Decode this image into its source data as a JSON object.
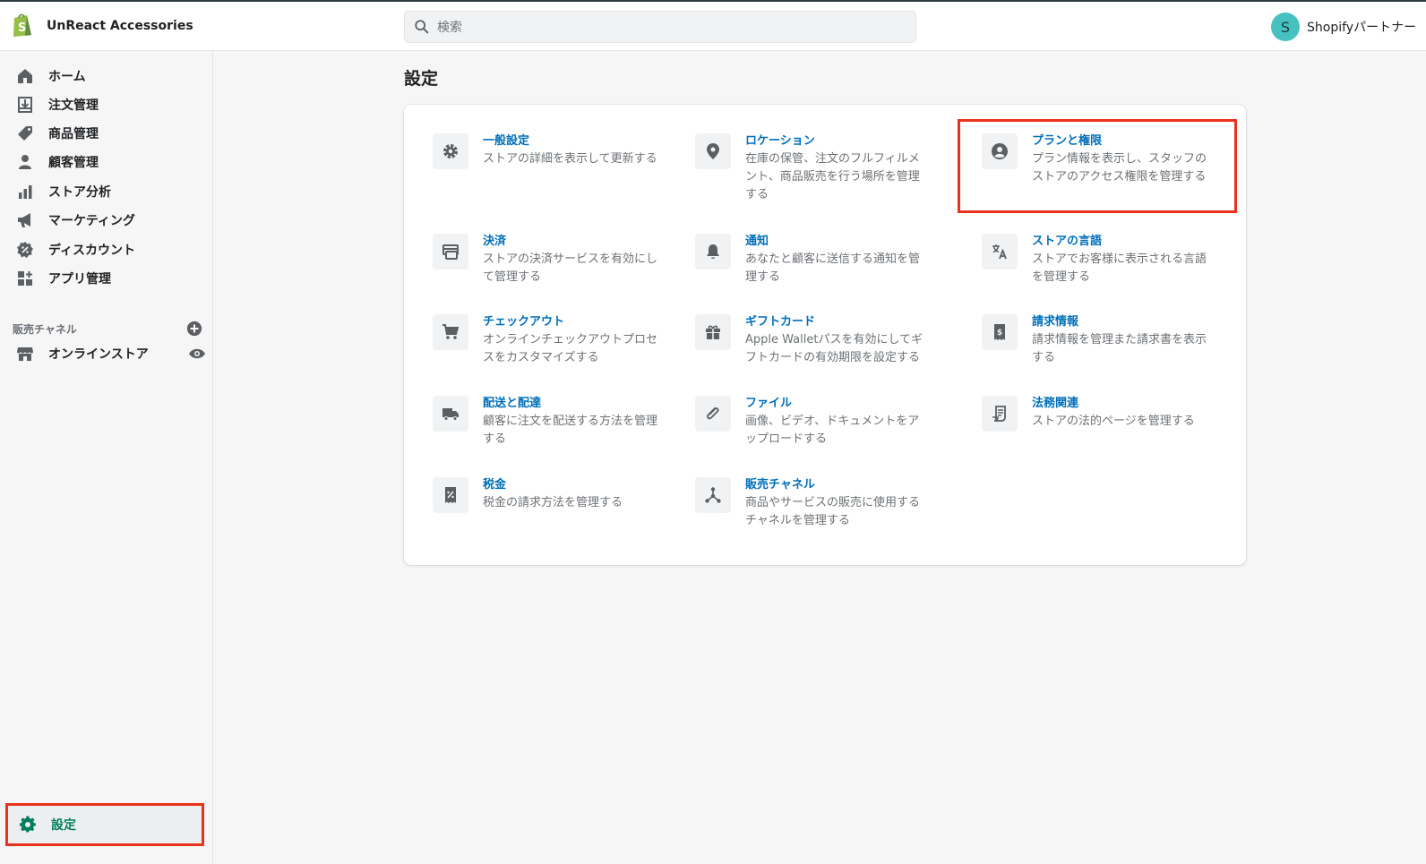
{
  "topbar": {
    "store_name": "UnReact Accessories",
    "search_placeholder": "検索",
    "avatar_initial": "S",
    "user_name": "Shopifyパートナー"
  },
  "sidebar": {
    "items": [
      {
        "label": "ホーム",
        "icon": "home-icon"
      },
      {
        "label": "注文管理",
        "icon": "orders-icon"
      },
      {
        "label": "商品管理",
        "icon": "tag-icon"
      },
      {
        "label": "顧客管理",
        "icon": "customer-icon"
      },
      {
        "label": "ストア分析",
        "icon": "analytics-icon"
      },
      {
        "label": "マーケティング",
        "icon": "megaphone-icon"
      },
      {
        "label": "ディスカウント",
        "icon": "discount-icon"
      },
      {
        "label": "アプリ管理",
        "icon": "apps-icon"
      }
    ],
    "channels_header": "販売チャネル",
    "channels": [
      {
        "label": "オンラインストア",
        "icon": "store-icon"
      }
    ],
    "settings_label": "設定"
  },
  "main": {
    "title": "設定",
    "settings": [
      {
        "title": "一般設定",
        "desc": "ストアの詳細を表示して更新する",
        "icon": "gear-icon"
      },
      {
        "title": "ロケーション",
        "desc": "在庫の保管、注文のフルフィルメント、商品販売を行う場所を管理する",
        "icon": "location-icon"
      },
      {
        "title": "プランと権限",
        "desc": "プラン情報を表示し、スタッフのストアのアクセス権限を管理する",
        "icon": "user-circle-icon"
      },
      {
        "title": "決済",
        "desc": "ストアの決済サービスを有効にして管理する",
        "icon": "payment-icon"
      },
      {
        "title": "通知",
        "desc": "あなたと顧客に送信する通知を管理する",
        "icon": "bell-icon"
      },
      {
        "title": "ストアの言語",
        "desc": "ストアでお客様に表示される言語を管理する",
        "icon": "translate-icon"
      },
      {
        "title": "チェックアウト",
        "desc": "オンラインチェックアウトプロセスをカスタマイズする",
        "icon": "cart-icon"
      },
      {
        "title": "ギフトカード",
        "desc": "Apple Walletパスを有効にしてギフトカードの有効期限を設定する",
        "icon": "gift-icon"
      },
      {
        "title": "請求情報",
        "desc": "請求情報を管理また請求書を表示する",
        "icon": "billing-icon"
      },
      {
        "title": "配送と配達",
        "desc": "顧客に注文を配送する方法を管理する",
        "icon": "truck-icon"
      },
      {
        "title": "ファイル",
        "desc": "画像、ビデオ、ドキュメントをアップロードする",
        "icon": "paperclip-icon"
      },
      {
        "title": "法務関連",
        "desc": "ストアの法的ページを管理する",
        "icon": "legal-icon"
      },
      {
        "title": "税金",
        "desc": "税金の請求方法を管理する",
        "icon": "tax-icon"
      },
      {
        "title": "販売チャネル",
        "desc": "商品やサービスの販売に使用するチャネルを管理する",
        "icon": "channels-icon"
      }
    ]
  },
  "colors": {
    "link": "#006fbb",
    "highlight": "#e8321e",
    "settings_active": "#007f5f",
    "icon_gray": "#5c5f62"
  }
}
